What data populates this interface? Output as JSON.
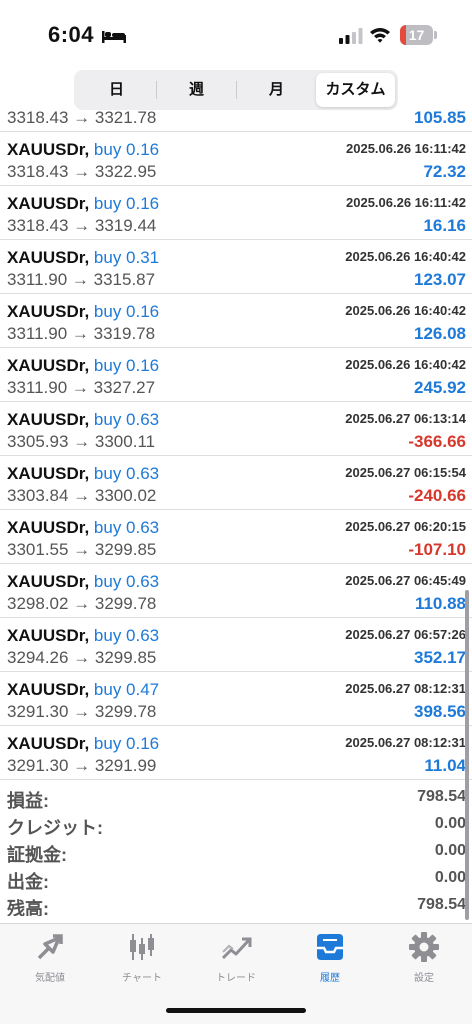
{
  "status_bar": {
    "time": "6:04",
    "battery": "17",
    "battery_level": 0.17
  },
  "segments": [
    {
      "label": "日",
      "active": false
    },
    {
      "label": "週",
      "active": false
    },
    {
      "label": "月",
      "active": false
    },
    {
      "label": "カスタム",
      "active": true
    }
  ],
  "partial_row": {
    "prices": "3318.43 → 3321.78",
    "profit": "105.85"
  },
  "trades": [
    {
      "symbol": "XAUUSDr,",
      "side": "buy 0.16",
      "time": "2025.06.26 16:11:42",
      "prices": "3318.43 → 3322.95",
      "profit": "72.32",
      "sign": "pos"
    },
    {
      "symbol": "XAUUSDr,",
      "side": "buy 0.16",
      "time": "2025.06.26 16:11:42",
      "prices": "3318.43 → 3319.44",
      "profit": "16.16",
      "sign": "pos"
    },
    {
      "symbol": "XAUUSDr,",
      "side": "buy 0.31",
      "time": "2025.06.26 16:40:42",
      "prices": "3311.90 → 3315.87",
      "profit": "123.07",
      "sign": "pos"
    },
    {
      "symbol": "XAUUSDr,",
      "side": "buy 0.16",
      "time": "2025.06.26 16:40:42",
      "prices": "3311.90 → 3319.78",
      "profit": "126.08",
      "sign": "pos"
    },
    {
      "symbol": "XAUUSDr,",
      "side": "buy 0.16",
      "time": "2025.06.26 16:40:42",
      "prices": "3311.90 → 3327.27",
      "profit": "245.92",
      "sign": "pos"
    },
    {
      "symbol": "XAUUSDr,",
      "side": "buy 0.63",
      "time": "2025.06.27 06:13:14",
      "prices": "3305.93 → 3300.11",
      "profit": "-366.66",
      "sign": "neg"
    },
    {
      "symbol": "XAUUSDr,",
      "side": "buy 0.63",
      "time": "2025.06.27 06:15:54",
      "prices": "3303.84 → 3300.02",
      "profit": "-240.66",
      "sign": "neg"
    },
    {
      "symbol": "XAUUSDr,",
      "side": "buy 0.63",
      "time": "2025.06.27 06:20:15",
      "prices": "3301.55 → 3299.85",
      "profit": "-107.10",
      "sign": "neg"
    },
    {
      "symbol": "XAUUSDr,",
      "side": "buy 0.63",
      "time": "2025.06.27 06:45:49",
      "prices": "3298.02 → 3299.78",
      "profit": "110.88",
      "sign": "pos"
    },
    {
      "symbol": "XAUUSDr,",
      "side": "buy 0.63",
      "time": "2025.06.27 06:57:26",
      "prices": "3294.26 → 3299.85",
      "profit": "352.17",
      "sign": "pos"
    },
    {
      "symbol": "XAUUSDr,",
      "side": "buy 0.47",
      "time": "2025.06.27 08:12:31",
      "prices": "3291.30 → 3299.78",
      "profit": "398.56",
      "sign": "pos"
    },
    {
      "symbol": "XAUUSDr,",
      "side": "buy 0.16",
      "time": "2025.06.27 08:12:31",
      "prices": "3291.30 → 3291.99",
      "profit": "11.04",
      "sign": "pos"
    }
  ],
  "summary": [
    {
      "label": "損益:",
      "value": "798.54"
    },
    {
      "label": "クレジット:",
      "value": "0.00"
    },
    {
      "label": "証拠金:",
      "value": "0.00"
    },
    {
      "label": "出金:",
      "value": "0.00"
    },
    {
      "label": "残高:",
      "value": "798.54"
    }
  ],
  "tabs": [
    {
      "label": "気配値",
      "icon": "quotes-icon",
      "active": false
    },
    {
      "label": "チャート",
      "icon": "chart-candles-icon",
      "active": false
    },
    {
      "label": "トレード",
      "icon": "trade-icon",
      "active": false
    },
    {
      "label": "履歴",
      "icon": "history-inbox-icon",
      "active": true
    },
    {
      "label": "設定",
      "icon": "gear-icon",
      "active": false
    }
  ],
  "colors": {
    "accent": "#1e7ad8",
    "loss": "#d8382c",
    "battery_low": "#e54a3f"
  }
}
